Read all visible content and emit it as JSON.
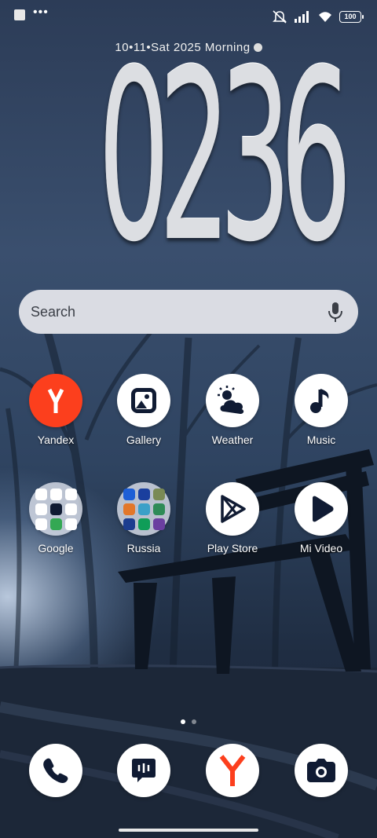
{
  "status_bar": {
    "left_icons": [
      "notification-square-icon",
      "more-dots-icon"
    ],
    "right_icons": [
      "silent-icon",
      "signal-icon",
      "wifi-icon",
      "battery-icon"
    ],
    "battery": "100"
  },
  "clock": {
    "date_line": "10•11•Sat  2025  Morning",
    "time": "0236"
  },
  "search": {
    "placeholder": "Search"
  },
  "apps": [
    {
      "label": "Yandex",
      "icon": "yandex-icon"
    },
    {
      "label": "Gallery",
      "icon": "gallery-icon"
    },
    {
      "label": "Weather",
      "icon": "weather-icon"
    },
    {
      "label": "Music",
      "icon": "music-icon"
    },
    {
      "label": "Google",
      "icon": "folder-icon"
    },
    {
      "label": "Russia",
      "icon": "folder-icon"
    },
    {
      "label": "Play Store",
      "icon": "play-store-icon"
    },
    {
      "label": "Mi Video",
      "icon": "mi-video-icon"
    }
  ],
  "page_indicator": {
    "pages": 2,
    "current": 1
  },
  "dock": [
    "phone-icon",
    "messages-icon",
    "yandex-browser-icon",
    "camera-icon"
  ],
  "colors": {
    "yandex_red": "#fc3f1d",
    "icon_dark": "#101b33"
  }
}
